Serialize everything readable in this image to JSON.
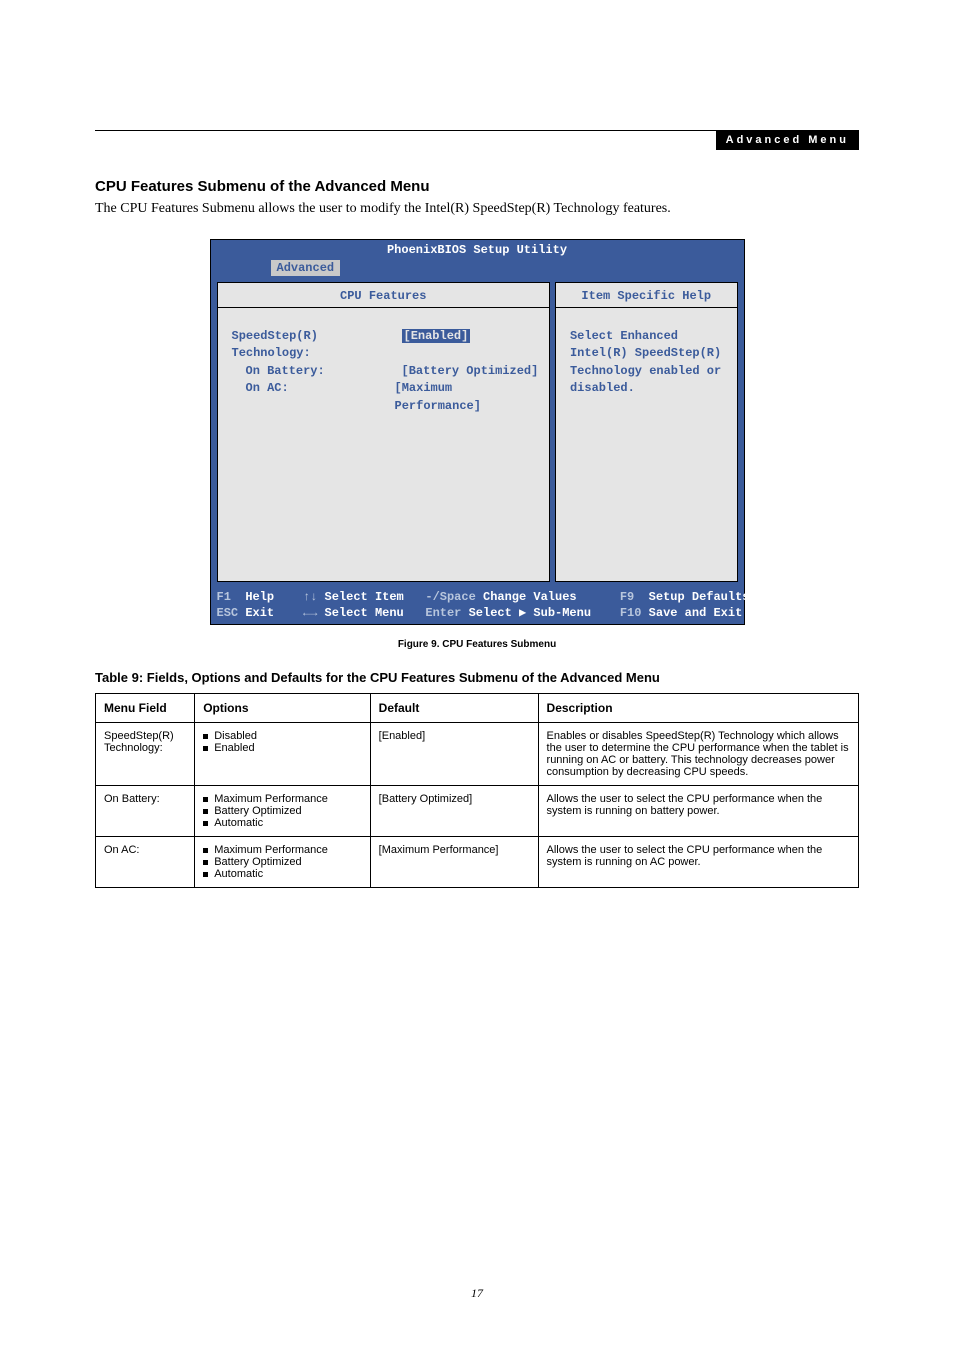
{
  "header": {
    "menu_label": "Advanced Menu"
  },
  "section": {
    "title": "CPU Features Submenu of the Advanced Menu",
    "intro": "The CPU Features Submenu allows the user to modify the Intel(R) SpeedStep(R) Technology features."
  },
  "bios": {
    "title": "PhoenixBIOS Setup Utility",
    "active_tab": "Advanced",
    "left_panel_title": "CPU Features",
    "right_panel_title": "Item Specific Help",
    "items": [
      {
        "label": "SpeedStep(R) Technology:",
        "value": "[Enabled]",
        "selected": true
      },
      {
        "label": "On Battery:",
        "value": "[Battery Optimized]",
        "selected": false
      },
      {
        "label": "On AC:",
        "value": "[Maximum Performance]",
        "selected": false
      }
    ],
    "help_lines": [
      "Select Enhanced",
      "Intel(R) SpeedStep(R)",
      "Technology enabled or",
      "disabled."
    ],
    "footer": {
      "row1": {
        "k1": "F1",
        "v1": "Help",
        "k2": "↑↓",
        "v2": "Select Item",
        "k3": "-/Space",
        "v3": "Change Values",
        "k4": "F9",
        "v4": "Setup Defaults"
      },
      "row2": {
        "k1": "ESC",
        "v1": "Exit",
        "k2": "←→",
        "v2": "Select Menu",
        "k3": "Enter",
        "v3": "Select ▶ Sub-Menu",
        "k4": "F10",
        "v4": "Save and Exit"
      }
    }
  },
  "figure_caption": "Figure 9.   CPU Features Submenu",
  "table_title": "Table 9: Fields, Options and Defaults for the CPU Features Submenu of the Advanced Menu",
  "table": {
    "headers": {
      "menu": "Menu Field",
      "options": "Options",
      "def": "Default",
      "desc": "Description"
    },
    "rows": [
      {
        "menu": "SpeedStep(R) Technology:",
        "options": [
          "Disabled",
          "Enabled"
        ],
        "def": "[Enabled]",
        "desc": "Enables or disables SpeedStep(R) Technology which allows the user to determine the CPU performance when the tablet is running on AC or battery. This technology decreases power consumption by decreasing CPU speeds."
      },
      {
        "menu": "On Battery:",
        "options": [
          "Maximum Performance",
          "Battery Optimized",
          "Automatic"
        ],
        "def": "[Battery Optimized]",
        "desc": "Allows the user to select the CPU performance when the system is running on battery power."
      },
      {
        "menu": "On AC:",
        "options": [
          "Maximum Performance",
          "Battery Optimized",
          "Automatic"
        ],
        "def": "[Maximum Performance]",
        "desc": "Allows the user to select the CPU performance when the system is running on AC power."
      }
    ]
  },
  "page_number": "17"
}
